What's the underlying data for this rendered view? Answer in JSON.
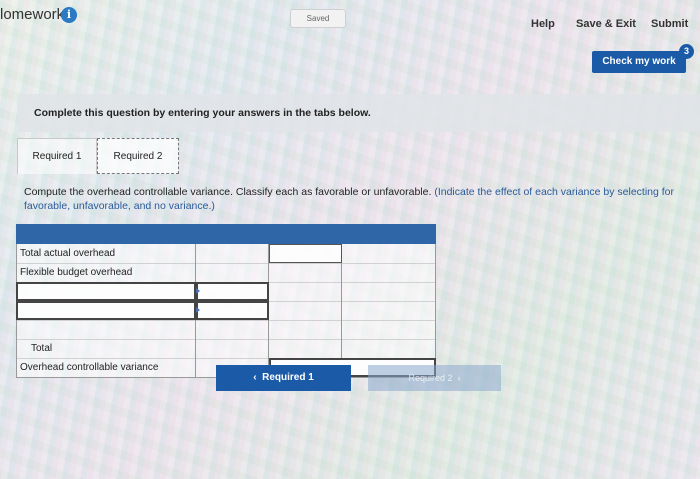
{
  "header": {
    "title": "lomework",
    "saved": "Saved",
    "help": "Help",
    "save_exit": "Save & Exit",
    "submit": "Submit",
    "info_icon": "i"
  },
  "check": {
    "label": "Check my work",
    "count": "3"
  },
  "instruction": "Complete this question by entering your answers in the tabs below.",
  "tabs": [
    {
      "label": "Required 1"
    },
    {
      "label": "Required 2"
    }
  ],
  "question": {
    "text": "Compute the overhead controllable variance. Classify each as favorable or unfavorable.",
    "hint": "(Indicate the effect of each variance by selecting for favorable, unfavorable, and no variance.)"
  },
  "table": {
    "rows": [
      {
        "label": "Total actual overhead"
      },
      {
        "label": "Flexible budget overhead"
      },
      {
        "label": ""
      },
      {
        "label": ""
      },
      {
        "label": "Total"
      },
      {
        "label": "Overhead controllable variance"
      }
    ]
  },
  "nav": {
    "prev_label": "Required 1",
    "prev_arrow": "‹",
    "next_label": "Required 2",
    "next_arrow": "›"
  },
  "colors": {
    "primary": "#1a5aa6",
    "table_header": "#2f66a8",
    "hint": "#2a5a9a"
  }
}
